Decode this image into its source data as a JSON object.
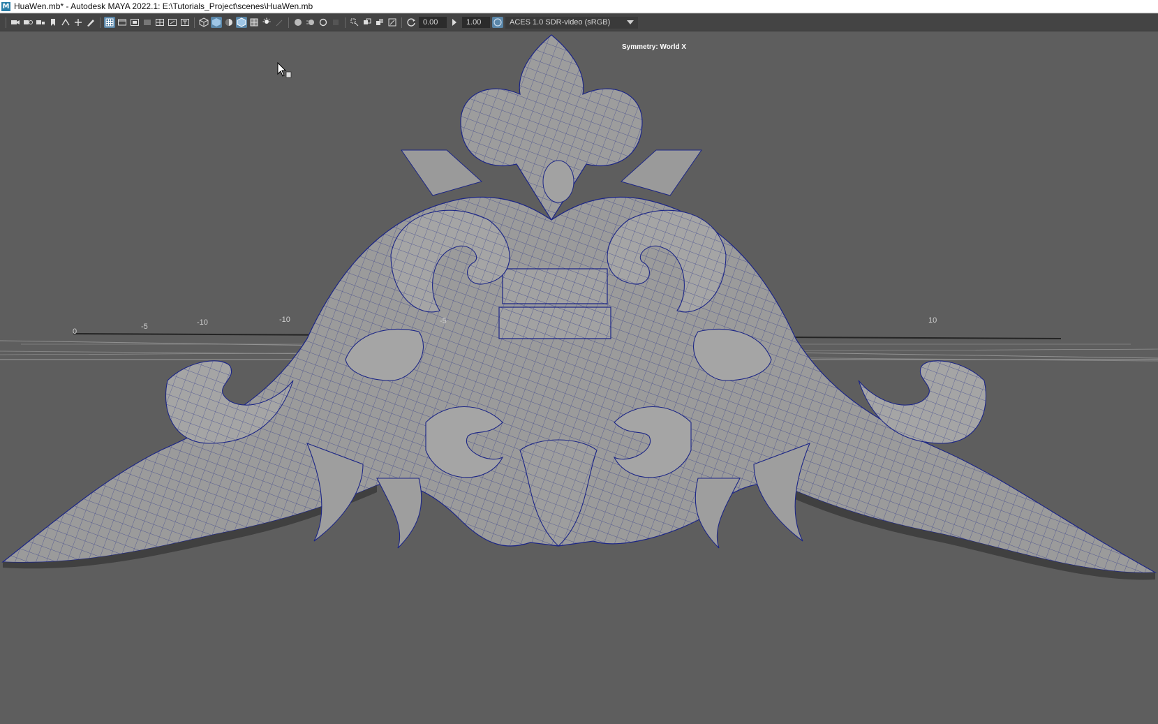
{
  "window": {
    "app_icon": "M",
    "title": "HuaWen.mb* - Autodesk MAYA 2022.1: E:\\Tutorials_Project\\scenes\\HuaWen.mb"
  },
  "toolbar": {
    "exposure_value": "0.00",
    "gamma_value": "1.00",
    "color_space": "ACES 1.0 SDR-video (sRGB)",
    "icons": [
      "camera-icon",
      "camera-attributes-icon",
      "bookmark-icon",
      "image-plane-icon",
      "grid-icon",
      "film-gate-icon",
      "resolution-gate-icon",
      "wireframe-icon",
      "smooth-shade-icon",
      "textured-icon",
      "lighting-icon",
      "shadows-icon",
      "isolate-select-icon",
      "xray-icon",
      "exposure-icon",
      "gamma-icon",
      "color-management-icon"
    ],
    "accent_color": "#5a86a8"
  },
  "viewport": {
    "symmetry_label": "Symmetry: World X",
    "grid_labels": [
      "0",
      "-5",
      "-10",
      "-10",
      "-5",
      "10"
    ],
    "mesh_color": "#9a9a9a",
    "wire_color": "#1f2a8a",
    "background_color": "#5e5e5e"
  }
}
